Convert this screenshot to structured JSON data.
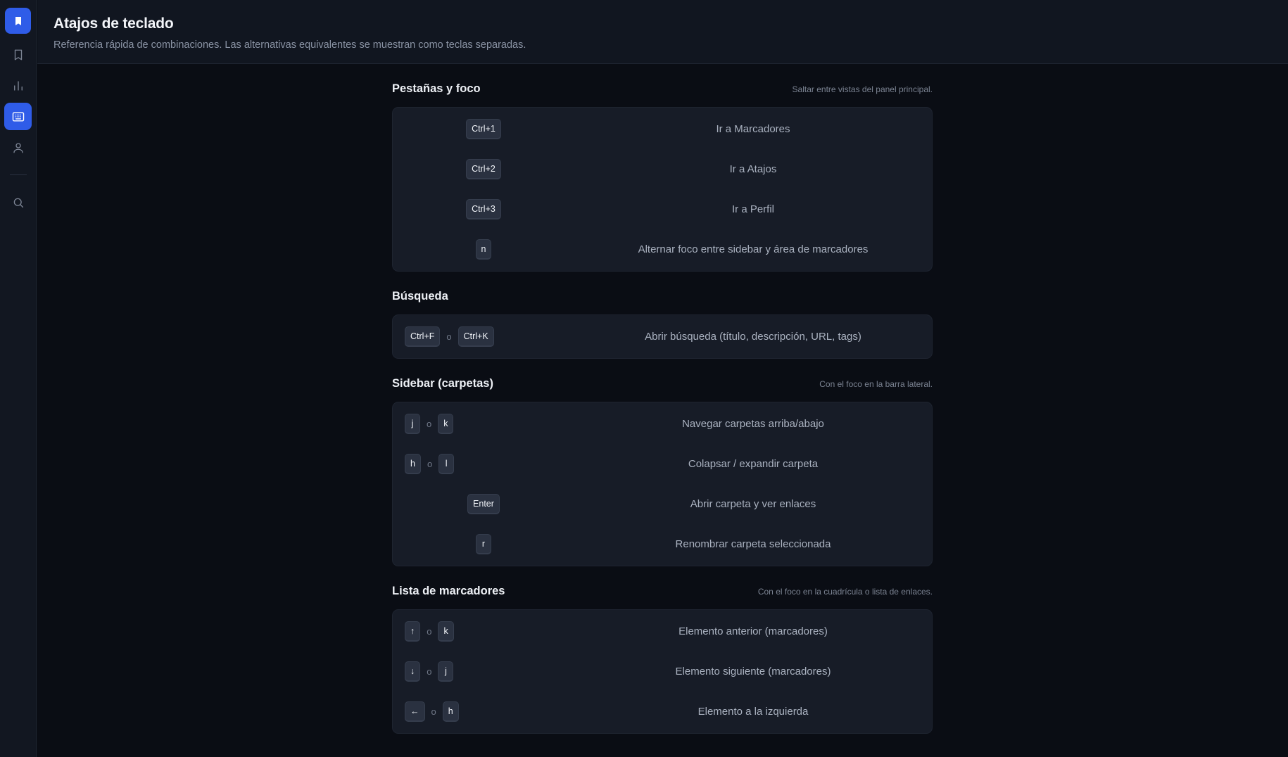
{
  "header": {
    "title": "Atajos de teclado",
    "subtitle": "Referencia rápida de combinaciones. Las alternativas equivalentes se muestran como teclas separadas."
  },
  "rail": {
    "items": [
      {
        "icon": "bookmark-icon",
        "active": false
      },
      {
        "icon": "bar-chart-icon",
        "active": false
      },
      {
        "icon": "keyboard-icon",
        "active": true
      },
      {
        "icon": "user-icon",
        "active": false
      },
      {
        "icon": "search-icon",
        "active": false
      }
    ]
  },
  "separator": "o",
  "sections": [
    {
      "title": "Pestañas y foco",
      "hint": "Saltar entre vistas del panel principal.",
      "rows": [
        {
          "keys": [
            "Ctrl+1"
          ],
          "desc": "Ir a Marcadores"
        },
        {
          "keys": [
            "Ctrl+2"
          ],
          "desc": "Ir a Atajos"
        },
        {
          "keys": [
            "Ctrl+3"
          ],
          "desc": "Ir a Perfil"
        },
        {
          "keys": [
            "n"
          ],
          "desc": "Alternar foco entre sidebar y área de marcadores"
        }
      ]
    },
    {
      "title": "Búsqueda",
      "hint": "",
      "rows": [
        {
          "keys": [
            "Ctrl+F",
            "Ctrl+K"
          ],
          "desc": "Abrir búsqueda (título, descripción, URL, tags)"
        }
      ]
    },
    {
      "title": "Sidebar (carpetas)",
      "hint": "Con el foco en la barra lateral.",
      "rows": [
        {
          "keys": [
            "j",
            "k"
          ],
          "desc": "Navegar carpetas arriba/abajo"
        },
        {
          "keys": [
            "h",
            "l"
          ],
          "desc": "Colapsar / expandir carpeta"
        },
        {
          "keys": [
            "Enter"
          ],
          "desc": "Abrir carpeta y ver enlaces"
        },
        {
          "keys": [
            "r"
          ],
          "desc": "Renombrar carpeta seleccionada"
        }
      ]
    },
    {
      "title": "Lista de marcadores",
      "hint": "Con el foco en la cuadrícula o lista de enlaces.",
      "rows": [
        {
          "keys": [
            "↑",
            "k"
          ],
          "desc": "Elemento anterior (marcadores)"
        },
        {
          "keys": [
            "↓",
            "j"
          ],
          "desc": "Elemento siguiente (marcadores)"
        },
        {
          "keys": [
            "←",
            "h"
          ],
          "desc": "Elemento a la izquierda"
        }
      ]
    }
  ]
}
